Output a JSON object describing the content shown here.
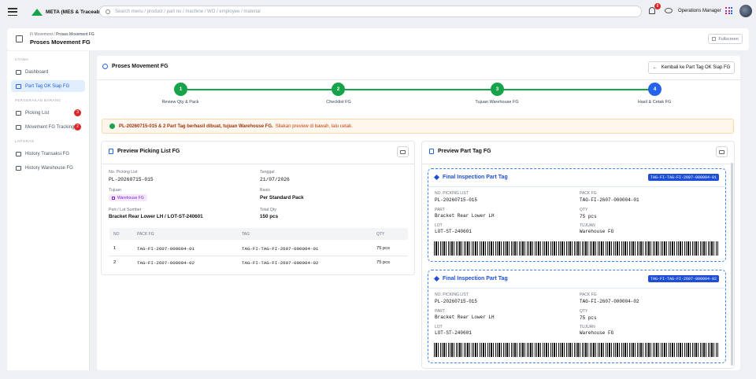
{
  "app": {
    "brand": "META (MES & Traceability)",
    "search_placeholder": "Search menu / product / part no / machine / WO / employee / material",
    "notif_count": "8",
    "role": "Operations Manager"
  },
  "header": {
    "crumb_parent": "Fi Movement",
    "crumb_current": "Proses Movement FG",
    "title": "Proses Movement FG",
    "fullscreen": "Fullscreen"
  },
  "sidebar": {
    "sec1": "UTAMA",
    "sec2": "PERGERAKAN BARANG",
    "sec3": "LAPORAN",
    "items": [
      {
        "label": "Dashboard"
      },
      {
        "label": "Part Tag OK Siap FG"
      },
      {
        "label": "Picking List",
        "count": "3"
      },
      {
        "label": "Movement FG Tracking",
        "count": "2"
      },
      {
        "label": "History Transaksi FG"
      },
      {
        "label": "History Warehouse FG"
      }
    ]
  },
  "main": {
    "title": "Proses Movement FG",
    "back": "Kembali ke Part Tag OK Siap FG",
    "steps": [
      {
        "num": "1",
        "label": "Review Qty & Pack"
      },
      {
        "num": "2",
        "label": "Checklist FG"
      },
      {
        "num": "3",
        "label": "Tujuan Warehouse FG"
      },
      {
        "num": "4",
        "label": "Hasil & Cetak FG"
      }
    ],
    "alert_bold": "PL-20260715-015 & 2 Part Tag berhasil dibuat, tujuan Warehouse FG.",
    "alert_rest": "Silakan preview di bawah, lalu cetak."
  },
  "picking": {
    "title": "Preview Picking List FG",
    "no_label": "No. Picking List",
    "no_value": "PL-20260715-015",
    "date_label": "Tanggal",
    "date_value": "21/07/2026",
    "dest_label": "Tujuan",
    "dest_value": "Warehouse FG",
    "basis_label": "Basis",
    "basis_value": "Per Standard Pack",
    "part_label": "Part / Lot Sumber",
    "part_value": "Bracket Rear Lower LH / LOT-ST-240601",
    "total_label": "Total Qty",
    "total_value": "150 pcs",
    "columns": [
      "NO",
      "PACK FG",
      "TAG",
      "QTY"
    ],
    "rows": [
      {
        "no": "1",
        "pack": "TAG-FI-2607-000004-01",
        "tag": "TAG-FI-TAG-FI-2607-000004-01",
        "qty": "75 pcs"
      },
      {
        "no": "2",
        "pack": "TAG-FI-2607-000004-02",
        "tag": "TAG-FI-TAG-FI-2607-000004-02",
        "qty": "75 pcs"
      }
    ]
  },
  "parttag": {
    "title": "Preview Part Tag FG",
    "tags": [
      {
        "title": "Final Inspection Part Tag",
        "badge": "TAG-FI-TAG-FI-2607-000004-01",
        "pl_label": "NO. PICKING LIST",
        "pl": "PL-20260715-015",
        "pack_label": "PACK FG",
        "pack": "TAG-FI-2607-000004-01",
        "part_label": "PART",
        "part": "Bracket Rear Lower LH",
        "qty_label": "QTY",
        "qty": "75 pcs",
        "lot_label": "LOT",
        "lot": "LOT-ST-240601",
        "dest_label": "TUJUAN",
        "dest": "Warehouse FG"
      },
      {
        "title": "Final Inspection Part Tag",
        "badge": "TAG-FI-TAG-FI-2607-000004-02",
        "pl_label": "NO. PICKING LIST",
        "pl": "PL-20260715-015",
        "pack_label": "PACK FG",
        "pack": "TAG-FI-2607-000004-02",
        "part_label": "PART",
        "part": "Bracket Rear Lower LH",
        "qty_label": "QTY",
        "qty": "75 pcs",
        "lot_label": "LOT",
        "lot": "LOT-ST-240601",
        "dest_label": "TUJUAN",
        "dest": "Warehouse FG"
      }
    ]
  },
  "colors": {
    "primary": "#2563eb",
    "success": "#16a34a",
    "danger": "#dc2626"
  }
}
